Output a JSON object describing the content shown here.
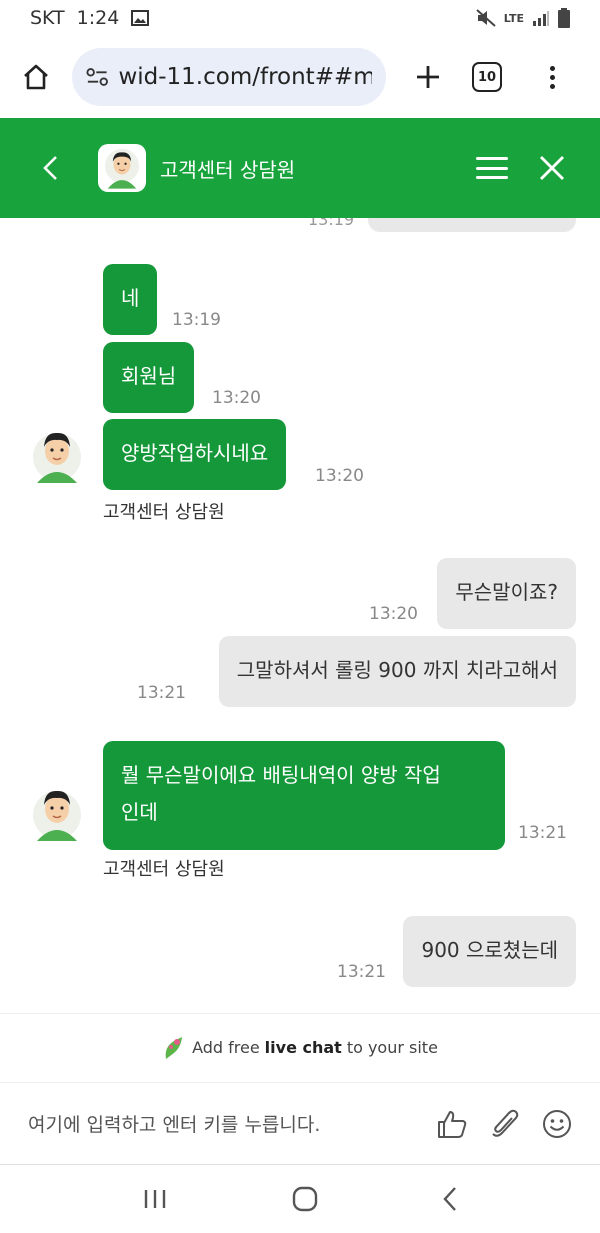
{
  "status_bar": {
    "carrier": "SKT",
    "time": "1:24",
    "network": "LTE"
  },
  "browser": {
    "url": "wid-11.com/front##ma",
    "tab_count": "10"
  },
  "chat_header": {
    "title": "고객센터 상담원"
  },
  "messages": [
    {
      "from": "agent",
      "text": "네",
      "time": "13:19"
    },
    {
      "from": "agent",
      "text": "회원님",
      "time": "13:20"
    },
    {
      "from": "agent",
      "text": "양방작업하시네요",
      "time": "13:20",
      "sender": "고객센터 상담원"
    },
    {
      "from": "user",
      "text": "무슨말이죠?",
      "time": "13:20"
    },
    {
      "from": "user",
      "text": "그말하셔서 롤링 900 까지 치라고해서",
      "time": "13:21"
    },
    {
      "from": "agent",
      "line1": "뭘 무슨말이에요 배팅내역이 양방 작업",
      "line2": "인데",
      "time": "13:21",
      "sender": "고객센터 상담원"
    },
    {
      "from": "user",
      "text": "900 으로쳤는데",
      "time": "13:21"
    }
  ],
  "partial_previous_time": "13:19",
  "footer": {
    "add_free": "Add free",
    "live_chat": "live chat",
    "to_your_site": "to your site"
  },
  "input": {
    "placeholder": "여기에 입력하고 엔터 키를 누릅니다."
  },
  "colors": {
    "brand_green": "#18a33c",
    "agent_bubble": "#15983a",
    "user_bubble": "#e8e8e8"
  }
}
